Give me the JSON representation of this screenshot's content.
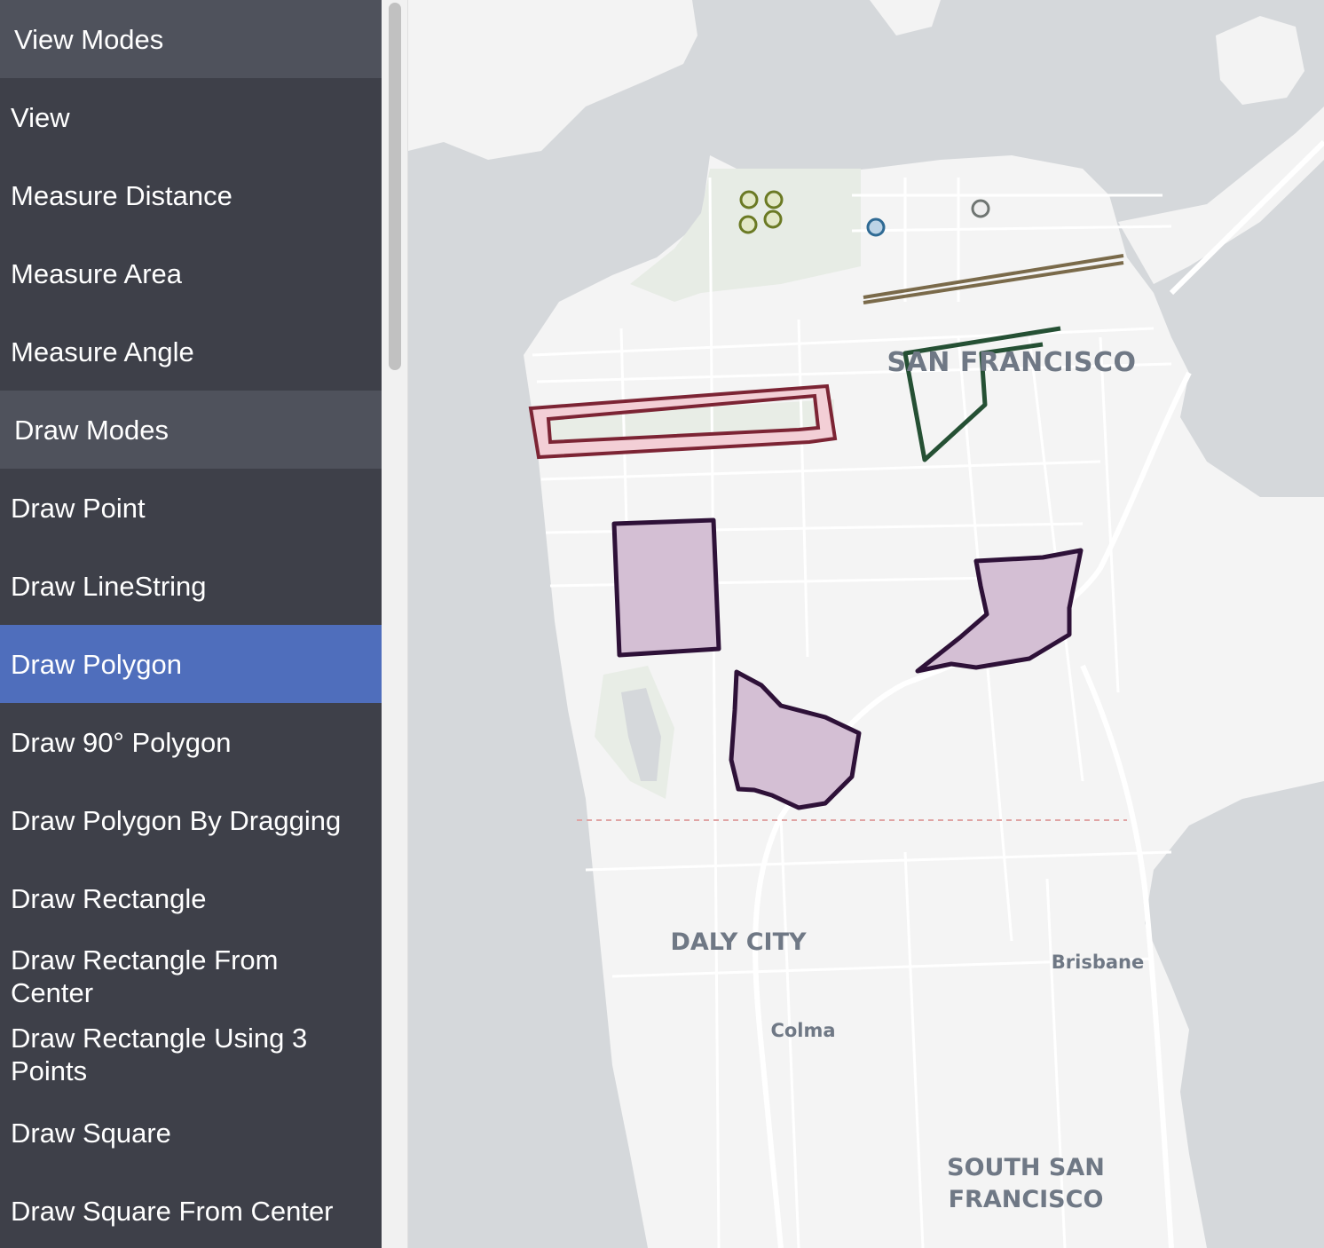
{
  "sidebar": {
    "items": [
      {
        "label": "View Modes",
        "kind": "section"
      },
      {
        "label": "View",
        "kind": "item"
      },
      {
        "label": "Measure Distance",
        "kind": "item"
      },
      {
        "label": "Measure Area",
        "kind": "item"
      },
      {
        "label": "Measure Angle",
        "kind": "item"
      },
      {
        "label": "Draw Modes",
        "kind": "section"
      },
      {
        "label": "Draw Point",
        "kind": "item"
      },
      {
        "label": "Draw LineString",
        "kind": "item"
      },
      {
        "label": "Draw Polygon",
        "kind": "item",
        "active": true
      },
      {
        "label": "Draw 90° Polygon",
        "kind": "item"
      },
      {
        "label": "Draw Polygon By Dragging",
        "kind": "item"
      },
      {
        "label": "Draw Rectangle",
        "kind": "item"
      },
      {
        "label": "Draw Rectangle From Center",
        "kind": "item"
      },
      {
        "label": "Draw Rectangle Using 3 Points",
        "kind": "item"
      },
      {
        "label": "Draw Square",
        "kind": "item"
      },
      {
        "label": "Draw Square From Center",
        "kind": "item"
      }
    ]
  },
  "map": {
    "labels": {
      "san_francisco": "SAN FRANCISCO",
      "daly_city": "DALY CITY",
      "brisbane": "Brisbane",
      "colma": "Colma",
      "south_sf_line1": "SOUTH SAN",
      "south_sf_line2": "FRANCISCO"
    },
    "colors": {
      "water": "#d5d8db",
      "land": "#f5f5f5",
      "sidebar": "#3e4049",
      "section": "#4f525c",
      "active": "#4f6ebc",
      "polygon_fill": "#d4bfd4",
      "polygon_stroke": "#2e1138",
      "red_outline": "#7c2434",
      "red_fill": "#f3cfd6",
      "green_line": "#255034",
      "tan_line": "#7a6a4a",
      "olive_point": "#6b7a24",
      "blue_point": "#2f6a94",
      "gray_point": "#6f7572"
    }
  }
}
